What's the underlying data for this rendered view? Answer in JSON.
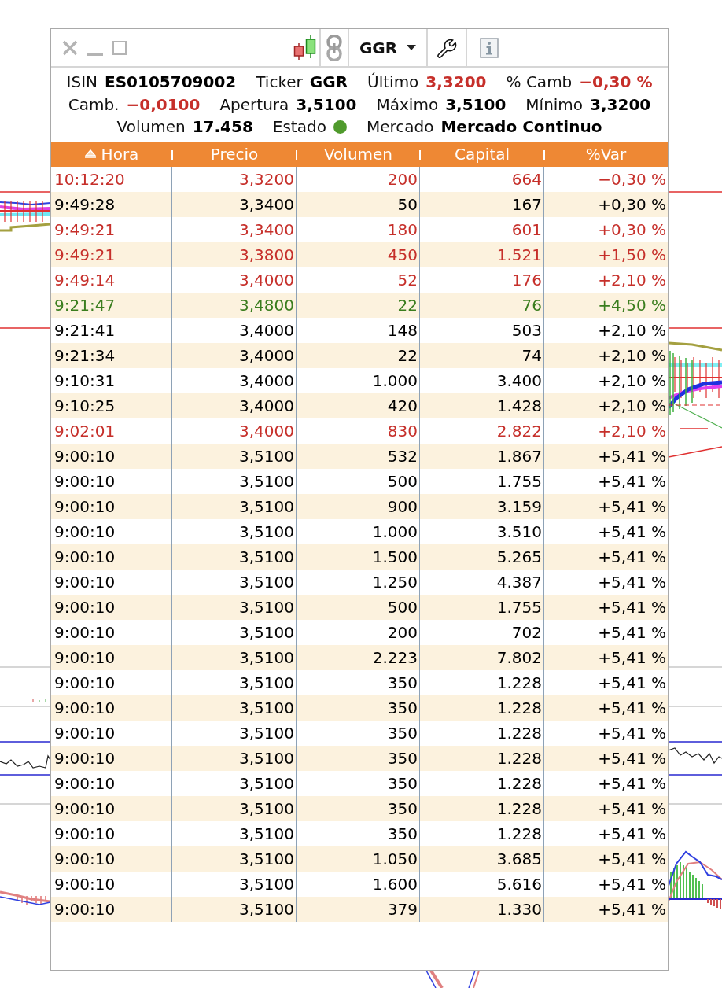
{
  "toolbar": {
    "ticker": "GGR"
  },
  "quote": {
    "lines": [
      [
        {
          "kind": "text",
          "label": "ISIN",
          "value": "ES0105709002",
          "color": "#000000"
        },
        {
          "kind": "text",
          "label": "Ticker",
          "value": "GGR",
          "color": "#000000"
        },
        {
          "kind": "text",
          "label": "Último",
          "value": "3,3200",
          "color": "#c62f2a"
        },
        {
          "kind": "text",
          "label": "% Camb",
          "value": "−0,30 %",
          "color": "#c62f2a"
        }
      ],
      [
        {
          "kind": "text",
          "label": "Camb.",
          "value": "−0,0100",
          "color": "#c62f2a"
        },
        {
          "kind": "text",
          "label": "Apertura",
          "value": "3,5100",
          "color": "#000000"
        },
        {
          "kind": "text",
          "label": "Máximo",
          "value": "3,5100",
          "color": "#000000"
        },
        {
          "kind": "text",
          "label": "Mínimo",
          "value": "3,3200",
          "color": "#000000"
        }
      ],
      [
        {
          "kind": "text",
          "label": "Volumen",
          "value": "17.458",
          "color": "#000000"
        },
        {
          "kind": "dot",
          "label": "Estado",
          "color": "#4f9a2c"
        },
        {
          "kind": "text",
          "label": "Mercado",
          "value": "Mercado Continuo",
          "color": "#000000"
        }
      ]
    ]
  },
  "table": {
    "columns": [
      {
        "label": "Hora",
        "sorted": true
      },
      {
        "label": "Precio",
        "sorted": false
      },
      {
        "label": "Volumen",
        "sorted": false
      },
      {
        "label": "Capital",
        "sorted": false
      },
      {
        "label": "%Var",
        "sorted": false
      }
    ],
    "rows": [
      {
        "color": "#c62f2a",
        "cells": [
          "10:12:20",
          "3,3200",
          "200",
          "664",
          "−0,30 %"
        ]
      },
      {
        "color": "#000000",
        "cells": [
          "9:49:28",
          "3,3400",
          "50",
          "167",
          "+0,30 %"
        ]
      },
      {
        "color": "#c62f2a",
        "cells": [
          "9:49:21",
          "3,3400",
          "180",
          "601",
          "+0,30 %"
        ]
      },
      {
        "color": "#c62f2a",
        "cells": [
          "9:49:21",
          "3,3800",
          "450",
          "1.521",
          "+1,50 %"
        ]
      },
      {
        "color": "#c62f2a",
        "cells": [
          "9:49:14",
          "3,4000",
          "52",
          "176",
          "+2,10 %"
        ]
      },
      {
        "color": "#3a7d1e",
        "cells": [
          "9:21:47",
          "3,4800",
          "22",
          "76",
          "+4,50 %"
        ]
      },
      {
        "color": "#000000",
        "cells": [
          "9:21:41",
          "3,4000",
          "148",
          "503",
          "+2,10 %"
        ]
      },
      {
        "color": "#000000",
        "cells": [
          "9:21:34",
          "3,4000",
          "22",
          "74",
          "+2,10 %"
        ]
      },
      {
        "color": "#000000",
        "cells": [
          "9:10:31",
          "3,4000",
          "1.000",
          "3.400",
          "+2,10 %"
        ]
      },
      {
        "color": "#000000",
        "cells": [
          "9:10:25",
          "3,4000",
          "420",
          "1.428",
          "+2,10 %"
        ]
      },
      {
        "color": "#c62f2a",
        "cells": [
          "9:02:01",
          "3,4000",
          "830",
          "2.822",
          "+2,10 %"
        ]
      },
      {
        "color": "#000000",
        "cells": [
          "9:00:10",
          "3,5100",
          "532",
          "1.867",
          "+5,41 %"
        ]
      },
      {
        "color": "#000000",
        "cells": [
          "9:00:10",
          "3,5100",
          "500",
          "1.755",
          "+5,41 %"
        ]
      },
      {
        "color": "#000000",
        "cells": [
          "9:00:10",
          "3,5100",
          "900",
          "3.159",
          "+5,41 %"
        ]
      },
      {
        "color": "#000000",
        "cells": [
          "9:00:10",
          "3,5100",
          "1.000",
          "3.510",
          "+5,41 %"
        ]
      },
      {
        "color": "#000000",
        "cells": [
          "9:00:10",
          "3,5100",
          "1.500",
          "5.265",
          "+5,41 %"
        ]
      },
      {
        "color": "#000000",
        "cells": [
          "9:00:10",
          "3,5100",
          "1.250",
          "4.387",
          "+5,41 %"
        ]
      },
      {
        "color": "#000000",
        "cells": [
          "9:00:10",
          "3,5100",
          "500",
          "1.755",
          "+5,41 %"
        ]
      },
      {
        "color": "#000000",
        "cells": [
          "9:00:10",
          "3,5100",
          "200",
          "702",
          "+5,41 %"
        ]
      },
      {
        "color": "#000000",
        "cells": [
          "9:00:10",
          "3,5100",
          "2.223",
          "7.802",
          "+5,41 %"
        ]
      },
      {
        "color": "#000000",
        "cells": [
          "9:00:10",
          "3,5100",
          "350",
          "1.228",
          "+5,41 %"
        ]
      },
      {
        "color": "#000000",
        "cells": [
          "9:00:10",
          "3,5100",
          "350",
          "1.228",
          "+5,41 %"
        ]
      },
      {
        "color": "#000000",
        "cells": [
          "9:00:10",
          "3,5100",
          "350",
          "1.228",
          "+5,41 %"
        ]
      },
      {
        "color": "#000000",
        "cells": [
          "9:00:10",
          "3,5100",
          "350",
          "1.228",
          "+5,41 %"
        ]
      },
      {
        "color": "#000000",
        "cells": [
          "9:00:10",
          "3,5100",
          "350",
          "1.228",
          "+5,41 %"
        ]
      },
      {
        "color": "#000000",
        "cells": [
          "9:00:10",
          "3,5100",
          "350",
          "1.228",
          "+5,41 %"
        ]
      },
      {
        "color": "#000000",
        "cells": [
          "9:00:10",
          "3,5100",
          "350",
          "1.228",
          "+5,41 %"
        ]
      },
      {
        "color": "#000000",
        "cells": [
          "9:00:10",
          "3,5100",
          "1.050",
          "3.685",
          "+5,41 %"
        ]
      },
      {
        "color": "#000000",
        "cells": [
          "9:00:10",
          "3,5100",
          "1.600",
          "5.616",
          "+5,41 %"
        ]
      },
      {
        "color": "#000000",
        "cells": [
          "9:00:10",
          "3,5100",
          "379",
          "1.330",
          "+5,41 %"
        ]
      }
    ]
  }
}
